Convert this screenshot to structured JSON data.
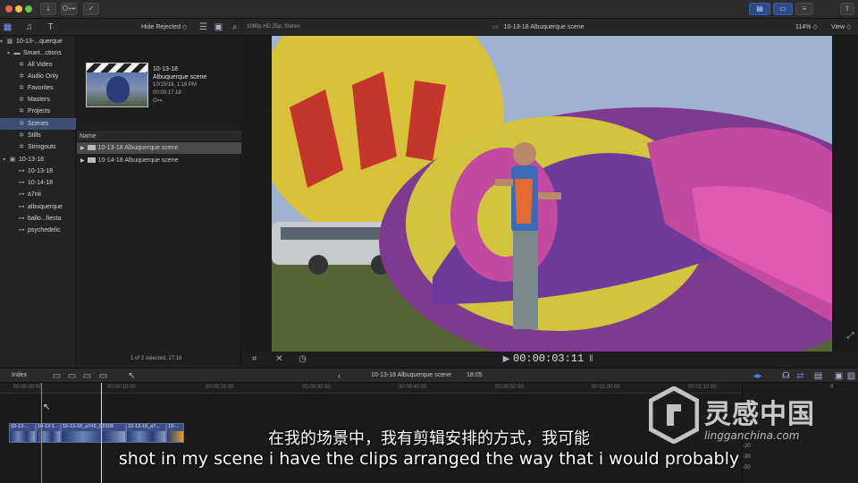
{
  "toolbar": {
    "key_label": "O⊶",
    "download_icon": "download-icon",
    "check_icon": "check-circle-icon"
  },
  "browser_header": {
    "filter": "Hide Rejected ◇",
    "resolution": "1080p HD 25p, Stereo"
  },
  "viewer_header": {
    "title": "10-13-18 Albuquerque scene",
    "zoom": "114% ◇",
    "view": "View ◇"
  },
  "sidebar": {
    "items": [
      {
        "label": "10-13-...querque",
        "indent": 0,
        "icon": "library-icon"
      },
      {
        "label": "Smart...ctions",
        "indent": 1,
        "icon": "folder-icon"
      },
      {
        "label": "All Video",
        "indent": 2,
        "icon": "smart-collection-icon"
      },
      {
        "label": "Audio Only",
        "indent": 2,
        "icon": "smart-collection-icon"
      },
      {
        "label": "Favorites",
        "indent": 2,
        "icon": "smart-collection-icon"
      },
      {
        "label": "Masters",
        "indent": 2,
        "icon": "smart-collection-icon"
      },
      {
        "label": "Projects",
        "indent": 2,
        "icon": "smart-collection-icon"
      },
      {
        "label": "Scenes",
        "indent": 2,
        "icon": "smart-collection-icon",
        "selected": true
      },
      {
        "label": "Stills",
        "indent": 2,
        "icon": "smart-collection-icon"
      },
      {
        "label": "Stringouts",
        "indent": 2,
        "icon": "smart-collection-icon"
      },
      {
        "label": "10-13-18",
        "indent": 0,
        "icon": "event-icon"
      },
      {
        "label": "10-13-18",
        "indent": 1,
        "icon": "keyword-icon"
      },
      {
        "label": "10-14-18",
        "indent": 1,
        "icon": "keyword-icon"
      },
      {
        "label": "a7riii",
        "indent": 1,
        "icon": "keyword-icon"
      },
      {
        "label": "albuquerque",
        "indent": 1,
        "icon": "keyword-icon"
      },
      {
        "label": "ballo...fiesta",
        "indent": 1,
        "icon": "keyword-icon"
      },
      {
        "label": "psychedelic",
        "indent": 1,
        "icon": "keyword-icon"
      }
    ]
  },
  "clip_info": {
    "title1": "10-13-18",
    "title2": "Albuquerque scene",
    "date": "10/15/18, 1:16 PM",
    "duration": "00:00:17:18",
    "keyword": "O⊶"
  },
  "list": {
    "header": "Name",
    "rows": [
      {
        "label": "10-13-18 Albuquerque scene",
        "selected": true
      },
      {
        "label": "10-14-18 Albuquerque scene",
        "selected": false
      }
    ],
    "status": "1 of 2 selected, 17:18"
  },
  "viewer_controls": {
    "timecode": "00:00:03:11"
  },
  "timeline": {
    "index_label": "Index",
    "project_title": "10-13-18 Albuquerque scene",
    "project_duration": "18:05",
    "ruler": [
      "00:00:00:00",
      "00:00:10:00",
      "00:00:20:00",
      "00:00:30:00",
      "00:00:40:00",
      "00:00:50:00",
      "00:01:00:00",
      "00:01:10:00"
    ],
    "clips": [
      {
        "label": "10-13-..."
      },
      {
        "label": "10-13-1..."
      },
      {
        "label": "10-13-18_a7rIII_C0109"
      },
      {
        "label": "10-13-18_a7..."
      },
      {
        "label": "10-..."
      }
    ],
    "meter_values": [
      "-20",
      "-30",
      "-50"
    ],
    "meter_top": "0"
  },
  "subtitles": {
    "cn": "在我的场景中，我有剪辑安排的方式，我可能",
    "en": "shot in my scene i have the clips arranged the way that i would probably"
  },
  "watermark": {
    "cn": "灵感中国",
    "url": "lingganchina.com"
  },
  "colors": {
    "selection_blue": "#3d4f73",
    "clip_blue": "#3b4f86",
    "toolbar_active": "#2d4a8a"
  }
}
